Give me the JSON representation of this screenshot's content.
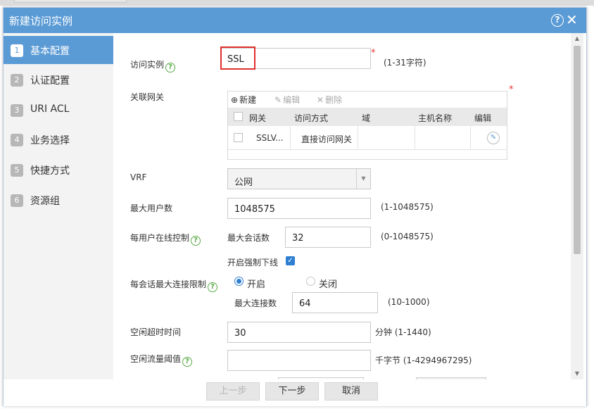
{
  "dialog": {
    "title": "新建访问实例"
  },
  "sidebar": {
    "steps": [
      {
        "num": "1",
        "label": "基本配置"
      },
      {
        "num": "2",
        "label": "认证配置"
      },
      {
        "num": "3",
        "label": "URI ACL"
      },
      {
        "num": "4",
        "label": "业务选择"
      },
      {
        "num": "5",
        "label": "快捷方式"
      },
      {
        "num": "6",
        "label": "资源组"
      }
    ],
    "active_step": 1
  },
  "form": {
    "instance": {
      "label": "访问实例",
      "value": "SSL",
      "hint": "(1-31字符)"
    },
    "gateway": {
      "label": "关联网关",
      "toolbar": {
        "new": "新建",
        "edit": "编辑",
        "delete": "删除"
      },
      "columns": [
        "网关",
        "访问方式",
        "域",
        "主机名称",
        "编辑"
      ],
      "rows": [
        {
          "gateway": "SSLV...",
          "access": "直接访问网关",
          "domain": "",
          "host": ""
        }
      ]
    },
    "vrf": {
      "label": "VRF",
      "value": "公网"
    },
    "max_users": {
      "label": "最大用户数",
      "value": "1048575",
      "hint": "(1-1048575)"
    },
    "online_ctrl": {
      "label": "每用户在线控制",
      "max_sessions_label": "最大会话数",
      "max_sessions_value": "32",
      "hint": "(0-1048575)",
      "force_offline_label": "开启强制下线",
      "force_offline_checked": true
    },
    "conn_limit": {
      "label": "每会话最大连接限制",
      "on_label": "开启",
      "off_label": "关闭",
      "selected": "on",
      "max_conn_label": "最大连接数",
      "max_conn_value": "64",
      "hint": "(10-1000)"
    },
    "idle_timeout": {
      "label": "空闲超时时间",
      "value": "30",
      "unit_hint": "分钟 (1-1440)"
    },
    "idle_traffic": {
      "label": "空闲流量阈值",
      "value": "",
      "unit_hint": "千字节 (1-4294967295)"
    }
  },
  "footer": {
    "prev": "上一步",
    "next": "下一步",
    "cancel": "取消"
  },
  "colors": {
    "accent": "#5b9bd5",
    "required": "#e53935",
    "help": "#5aab46",
    "highlight": "#e0302c"
  }
}
